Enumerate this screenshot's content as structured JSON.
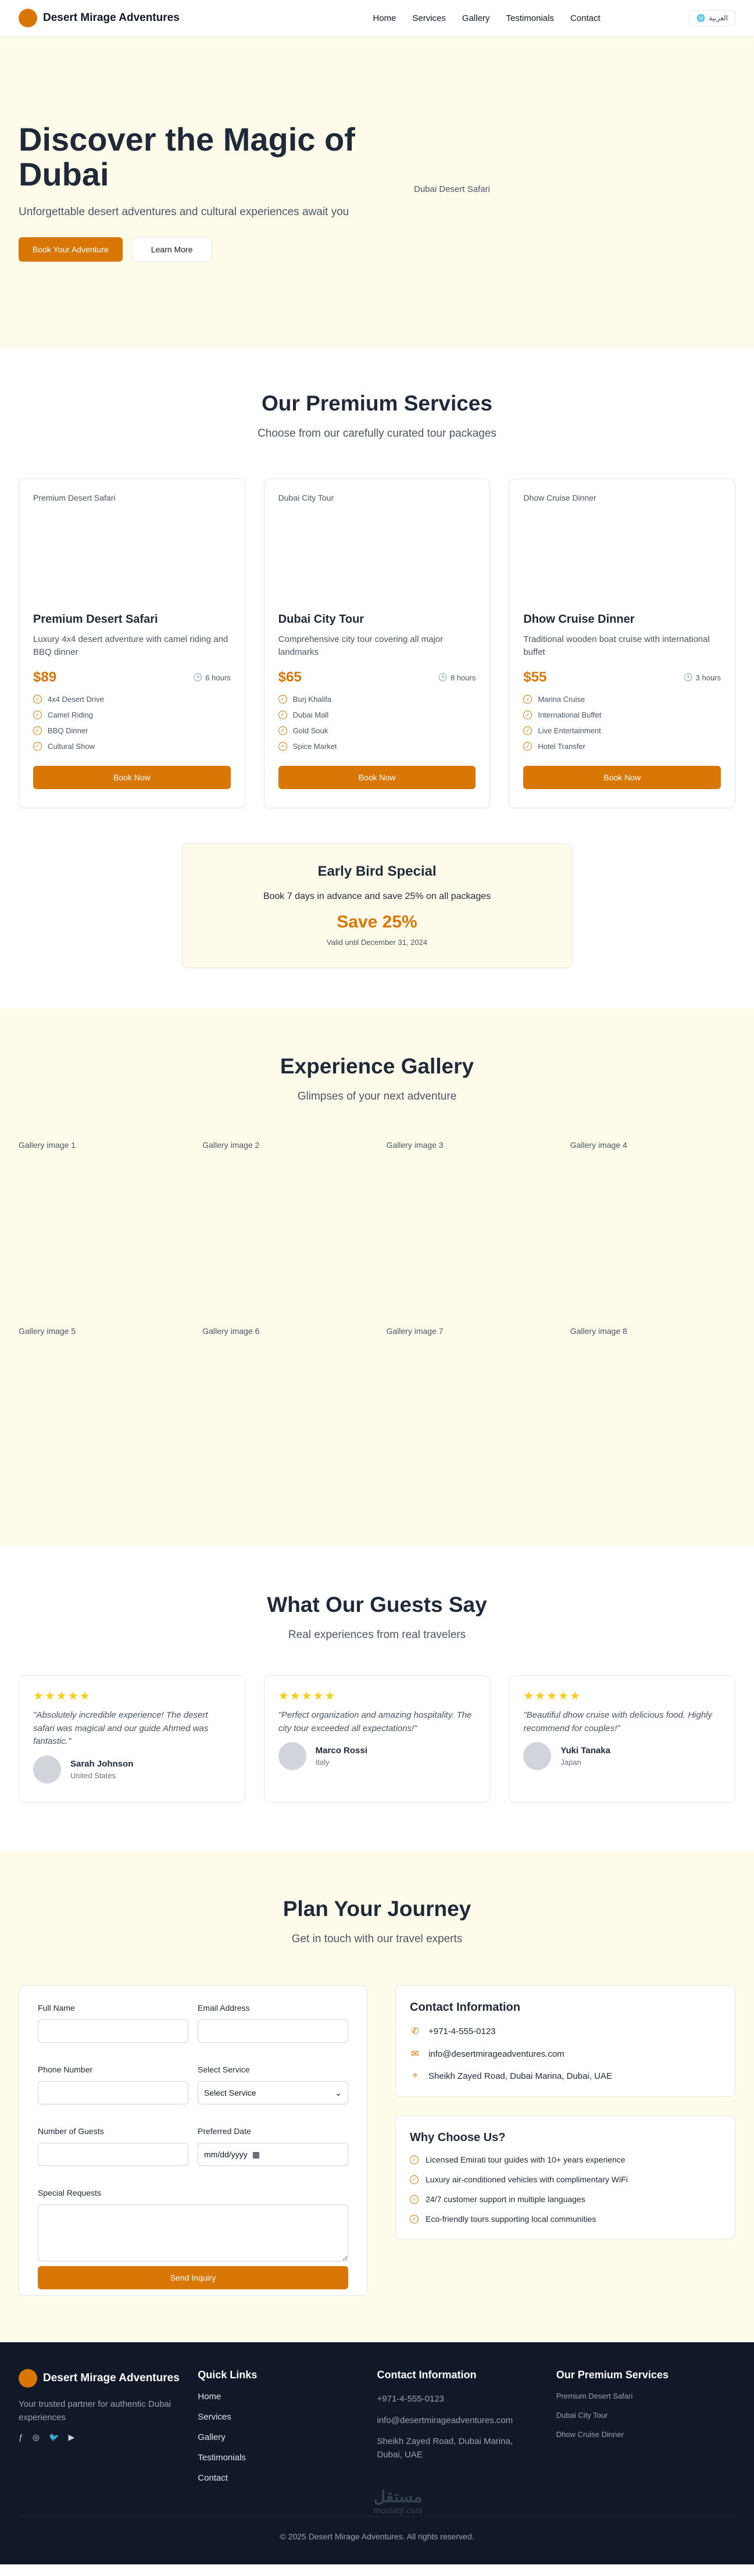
{
  "header": {
    "brand": "Desert Mirage Adventures",
    "nav": [
      "Home",
      "Services",
      "Gallery",
      "Testimonials",
      "Contact"
    ],
    "lang_button": "العربية"
  },
  "hero": {
    "title": "Discover the Magic of Dubai",
    "subtitle": "Unforgettable desert adventures and cultural experiences await you",
    "primary_button": "Book Your Adventure",
    "secondary_button": "Learn More",
    "image_alt": "Dubai Desert Safari"
  },
  "services": {
    "title": "Our Premium Services",
    "subtitle": "Choose from our carefully curated tour packages",
    "cards": [
      {
        "image_alt": "Premium Desert Safari",
        "title": "Premium Desert Safari",
        "description": "Luxury 4x4 desert adventure with camel riding and BBQ dinner",
        "price": "$89",
        "duration": "6 hours",
        "features": [
          "4x4 Desert Drive",
          "Camel Riding",
          "BBQ Dinner",
          "Cultural Show"
        ],
        "button": "Book Now"
      },
      {
        "image_alt": "Dubai City Tour",
        "title": "Dubai City Tour",
        "description": "Comprehensive city tour covering all major landmarks",
        "price": "$65",
        "duration": "8 hours",
        "features": [
          "Burj Khalifa",
          "Dubai Mall",
          "Gold Souk",
          "Spice Market"
        ],
        "button": "Book Now"
      },
      {
        "image_alt": "Dhow Cruise Dinner",
        "title": "Dhow Cruise Dinner",
        "description": "Traditional wooden boat cruise with international buffet",
        "price": "$55",
        "duration": "3 hours",
        "features": [
          "Marina Cruise",
          "International Buffet",
          "Live Entertainment",
          "Hotel Transfer"
        ],
        "button": "Book Now"
      }
    ]
  },
  "special": {
    "title": "Early Bird Special",
    "text": "Book 7 days in advance and save 25% on all packages",
    "save": "Save 25%",
    "valid": "Valid until December 31, 2024"
  },
  "gallery": {
    "title": "Experience Gallery",
    "subtitle": "Glimpses of your next adventure",
    "items": [
      "Gallery image 1",
      "Gallery image 2",
      "Gallery image 3",
      "Gallery image 4",
      "Gallery image 5",
      "Gallery image 6",
      "Gallery image 7",
      "Gallery image 8"
    ]
  },
  "testimonials": {
    "title": "What Our Guests Say",
    "subtitle": "Real experiences from real travelers",
    "items": [
      {
        "stars": "★★★★★",
        "quote": "\"Absolutely incredible experience! The desert safari was magical and our guide Ahmed was fantastic.\"",
        "name": "Sarah Johnson",
        "location": "United States"
      },
      {
        "stars": "★★★★★",
        "quote": "\"Perfect organization and amazing hospitality. The city tour exceeded all expectations!\"",
        "name": "Marco Rossi",
        "location": "Italy"
      },
      {
        "stars": "★★★★★",
        "quote": "\"Beautiful dhow cruise with delicious food. Highly recommend for couples!\"",
        "name": "Yuki Tanaka",
        "location": "Japan"
      }
    ]
  },
  "contact": {
    "title": "Plan Your Journey",
    "subtitle": "Get in touch with our travel experts",
    "form": {
      "full_name": "Full Name",
      "email": "Email Address",
      "phone": "Phone Number",
      "service": "Select Service",
      "service_value": "Select Service",
      "guests": "Number of Guests",
      "date": "Preferred Date",
      "date_value": "mm/dd/yyyy",
      "requests": "Special Requests",
      "submit": "Send Inquiry"
    },
    "info": {
      "title": "Contact Information",
      "phone": "+971-4-555-0123",
      "email": "info@desertmirageadventures.com",
      "address": "Sheikh Zayed Road, Dubai Marina, Dubai, UAE"
    },
    "why": {
      "title": "Why Choose Us?",
      "items": [
        "Licensed Emirati tour guides with 10+ years experience",
        "Luxury air-conditioned vehicles with complimentary WiFi",
        "24/7 customer support in multiple languages",
        "Eco-friendly tours supporting local communities"
      ]
    }
  },
  "footer": {
    "brand": "Desert Mirage Adventures",
    "tagline": "Your trusted partner for authentic Dubai experiences",
    "quick_links_title": "Quick Links",
    "quick_links": [
      "Home",
      "Services",
      "Gallery",
      "Testimonials",
      "Contact"
    ],
    "contact_title": "Contact Information",
    "phone": "+971-4-555-0123",
    "email": "info@desertmirageadventures.com",
    "address": "Sheikh Zayed Road, Dubai Marina, Dubai, UAE",
    "services_title": "Our Premium Services",
    "services": [
      "Premium Desert Safari",
      "Dubai City Tour",
      "Dhow Cruise Dinner"
    ],
    "copyright": "© 2025 Desert Mirage Adventures. All rights reserved.",
    "watermark": "مستقل",
    "watermark_sub": "mostaql.com"
  },
  "colors": {
    "accent": "#d97706",
    "cream": "#fffbeb",
    "footer_bg": "#111827"
  }
}
